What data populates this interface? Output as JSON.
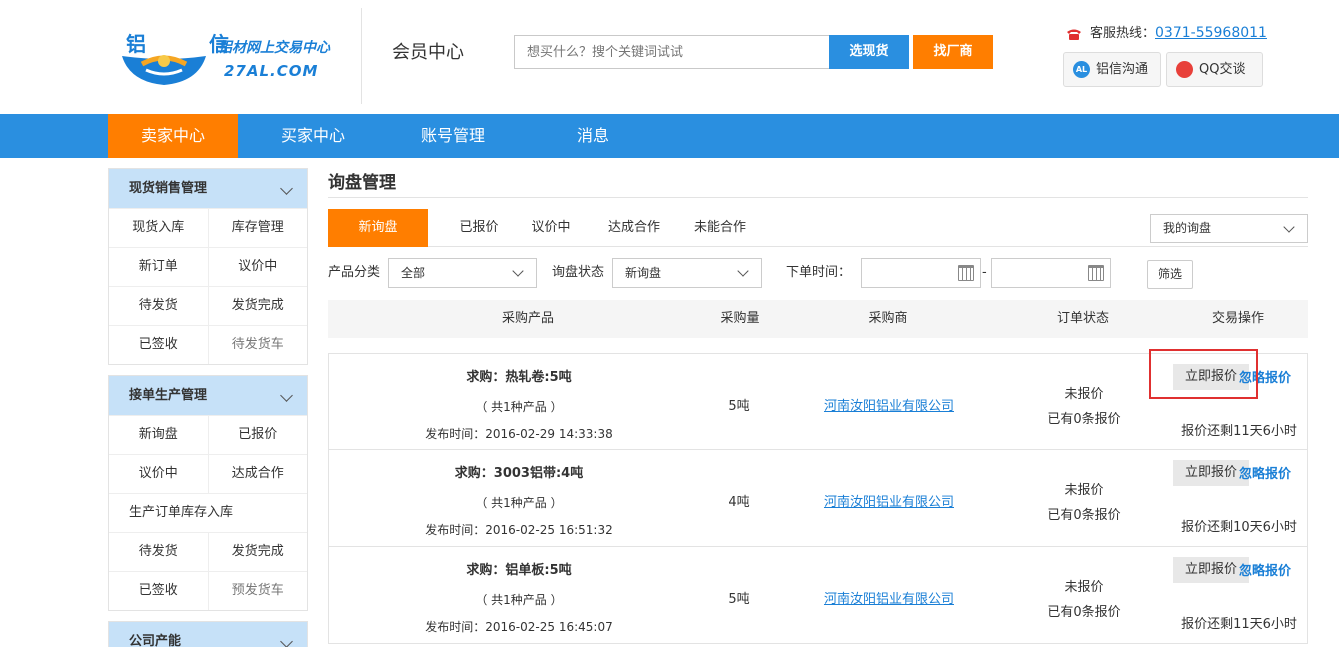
{
  "logo": {
    "chars": "铝 信",
    "slogan": "铝材网上交易中心",
    "domain": "27AL.COM"
  },
  "header": {
    "member_title": "会员中心",
    "search_placeholder": "想买什么？搜个关键词试试",
    "btn_spot": "选现货",
    "btn_factory": "找厂商",
    "hotline_label": "客服热线：",
    "hotline_number": "0371-55968011",
    "chat_al": "铝信沟通",
    "chat_al_icon_text": "AL",
    "chat_qq": "QQ交谈"
  },
  "nav": {
    "items": [
      "卖家中心",
      "买家中心",
      "账号管理",
      "消息"
    ],
    "active_index": 0
  },
  "sidebar": {
    "groups": [
      {
        "title": "现货销售管理",
        "rows": [
          [
            "现货入库",
            "库存管理"
          ],
          [
            "新订单",
            "议价中"
          ],
          [
            "待发货",
            "发货完成"
          ],
          [
            "已签收",
            "待发货车"
          ]
        ]
      },
      {
        "title": "接单生产管理",
        "rows": [
          [
            "新询盘",
            "已报价"
          ],
          [
            "议价中",
            "达成合作"
          ],
          [
            "生产订单库存入库"
          ],
          [
            "待发货",
            "发货完成"
          ],
          [
            "已签收",
            "预发货车"
          ]
        ]
      },
      {
        "title": "公司产能"
      }
    ]
  },
  "main": {
    "title": "询盘管理",
    "tabs": [
      "新询盘",
      "已报价",
      "议价中",
      "达成合作",
      "未能合作"
    ],
    "my_select": "我的询盘",
    "filter": {
      "category_label": "产品分类",
      "category_value": "全部",
      "status_label": "询盘状态",
      "status_value": "新询盘",
      "time_label": "下单时间：",
      "dash": "-",
      "btn": "筛选"
    },
    "columns": [
      "采购产品",
      "采购量",
      "采购商",
      "订单状态",
      "交易操作"
    ],
    "rows": [
      {
        "title": "求购：热轧卷:5吨",
        "count": "（ 共1种产品 ）",
        "time": "发布时间：2016-02-29 14:33:38",
        "qty": "5吨",
        "buyer": "河南汝阳铝业有限公司",
        "status1": "未报价",
        "status2": "已有0条报价",
        "quote": "立即报价",
        "ignore": "忽略报价",
        "remain": "报价还剩11天6小时"
      },
      {
        "title": "求购：3003铝带:4吨",
        "count": "（ 共1种产品 ）",
        "time": "发布时间：2016-02-25 16:51:32",
        "qty": "4吨",
        "buyer": "河南汝阳铝业有限公司",
        "status1": "未报价",
        "status2": "已有0条报价",
        "quote": "立即报价",
        "ignore": "忽略报价",
        "remain": "报价还剩10天6小时"
      },
      {
        "title": "求购：铝单板:5吨",
        "count": "（ 共1种产品 ）",
        "time": "发布时间：2016-02-25 16:45:07",
        "qty": "5吨",
        "buyer": "河南汝阳铝业有限公司",
        "status1": "未报价",
        "status2": "已有0条报价",
        "quote": "立即报价",
        "ignore": "忽略报价",
        "remain": "报价还剩11天6小时"
      }
    ]
  },
  "colors": {
    "primary_blue": "#2a8fe0",
    "accent_orange": "#ff7e00",
    "link_blue": "#1a7fd6",
    "highlight_red": "#e03030",
    "sidebar_head": "#c6e1f8"
  }
}
